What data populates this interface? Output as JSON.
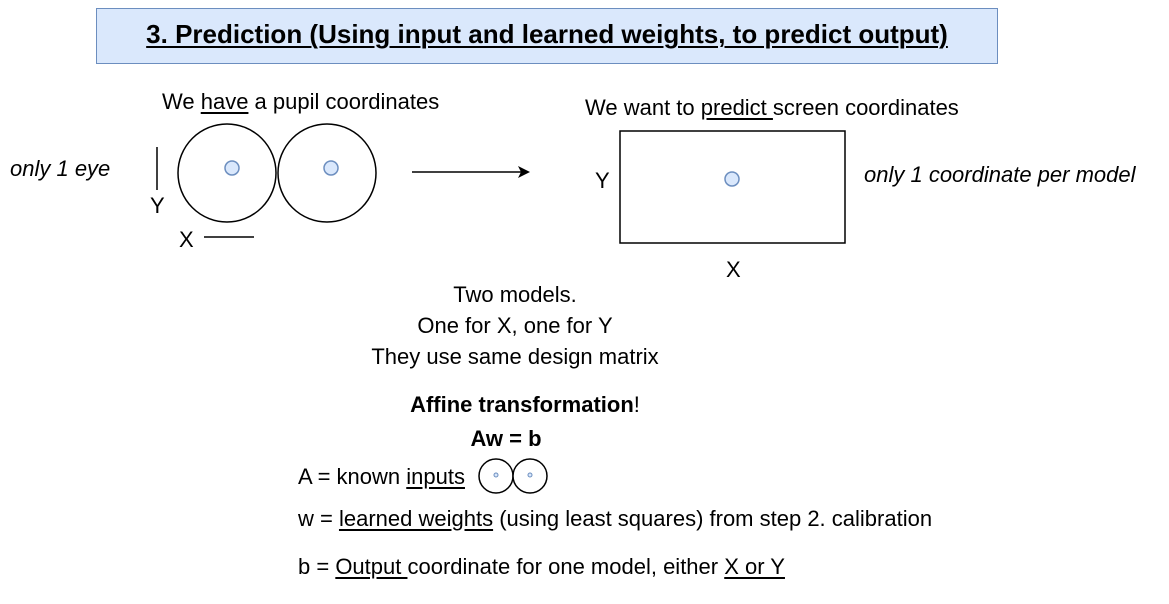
{
  "title": "3. Prediction (Using input and learned weights, to predict output)",
  "left": {
    "caption_pre": "We ",
    "caption_underline": "have",
    "caption_post": " a pupil coordinates",
    "side_note": "only 1 eye",
    "axis_y": "Y",
    "axis_x": "X"
  },
  "right": {
    "caption_pre": "We want to ",
    "caption_underline": "predict ",
    "caption_post": "screen coordinates",
    "side_note": "only 1 coordinate per model",
    "axis_y": "Y",
    "axis_x": "X"
  },
  "models": {
    "line1": "Two models.",
    "line2": "One for X, one for Y",
    "line3": "They use same design matrix"
  },
  "affine": {
    "heading_bold": "Affine transformation",
    "heading_rest": "!",
    "equation": "Aw = b"
  },
  "definitions": {
    "a_pre": "A = known ",
    "a_underline": "inputs",
    "w_pre": "w = ",
    "w_underline": "learned weights",
    "w_post": " (using least squares) from step 2. calibration",
    "b_pre": "b = ",
    "b_underline": "Output ",
    "b_mid": "coordinate for one model, either ",
    "b_underline2": "X or Y"
  },
  "colors": {
    "title_fill": "#dae8fc",
    "title_stroke": "#6c8ebf",
    "pupil_fill": "#dae8fc",
    "pupil_stroke": "#6c8ebf"
  }
}
